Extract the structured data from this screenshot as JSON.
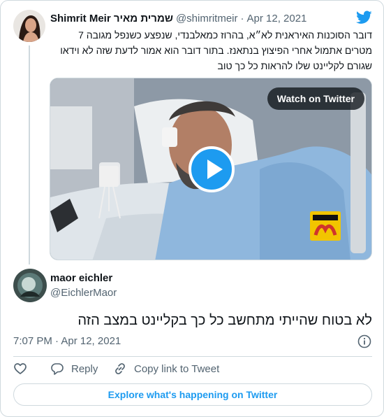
{
  "parent_tweet": {
    "author_name": "Shimrit Meir שמרית מאיר",
    "handle": "@shimritmeir",
    "separator": "·",
    "date": "Apr 12, 2021",
    "text": "דובר הסוכנות האיראנית לא״א, בהרוז כמאלבנדי, שנפצע כשנפל מגובה 7 מטרים אתמול אחרי הפיצוץ בנתאנז. בתור דובר הוא אמור לדעת שזה לא וידאו שגורם לקליינט שלו להראות כל כך טוב",
    "media": {
      "watch_label": "Watch on Twitter",
      "logo_text": "IRNA 24"
    }
  },
  "main_tweet": {
    "author_name": "maor eichler",
    "handle": "@EichlerMaor",
    "text": "לא בטוח שהייתי מתחשב כל כך בקליינט במצב הזה",
    "time": "7:07 PM · Apr 12, 2021"
  },
  "actions": {
    "like_label": "",
    "reply_label": "Reply",
    "copy_label": "Copy link to Tweet"
  },
  "explore_label": "Explore what's happening on Twitter",
  "colors": {
    "accent": "#1d9bf0",
    "secondary_text": "#536471",
    "border": "#cfd9de"
  },
  "icons": [
    "twitter-bird-icon",
    "play-icon",
    "info-icon",
    "heart-icon",
    "reply-icon",
    "copy-link-icon"
  ]
}
